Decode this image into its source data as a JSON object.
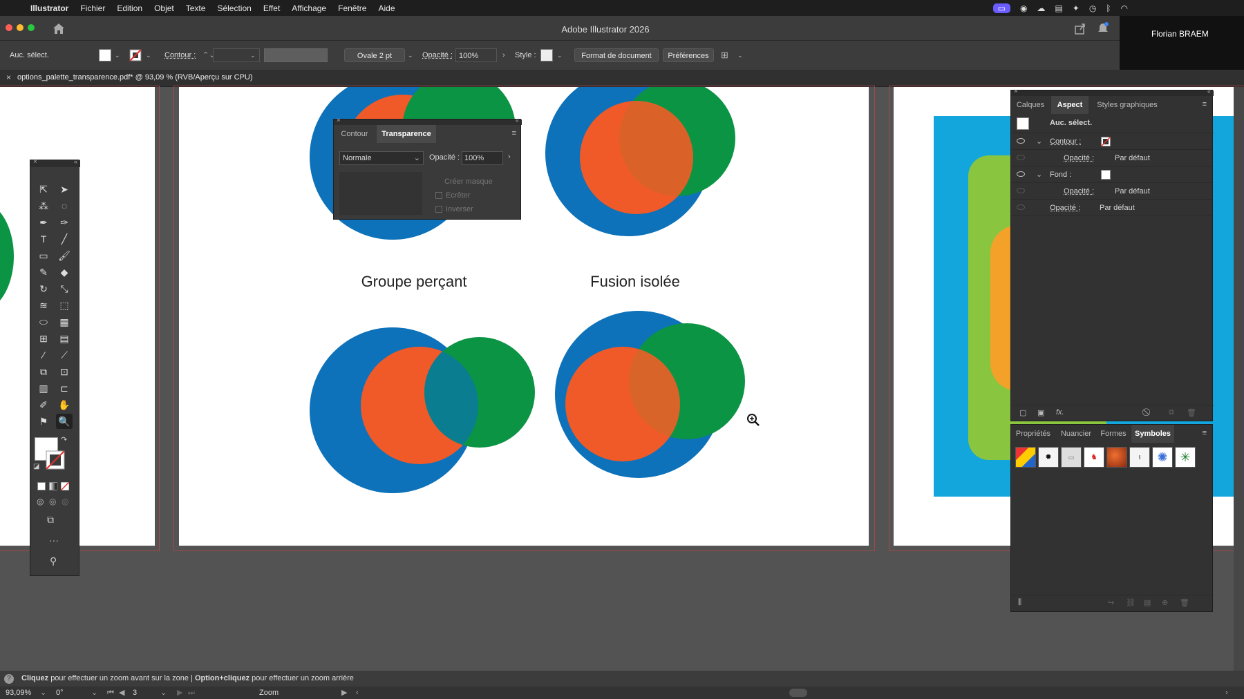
{
  "menubar": {
    "app_name": "Illustrator",
    "items": [
      "Fichier",
      "Edition",
      "Objet",
      "Texte",
      "Sélection",
      "Effet",
      "Affichage",
      "Fenêtre",
      "Aide"
    ]
  },
  "window": {
    "title": "Adobe Illustrator 2026",
    "user": "Florian BRAEM"
  },
  "controlbar": {
    "selection": "Auc. sélect.",
    "contour_label": "Contour :",
    "brush": "Ovale 2 pt",
    "opacity_label": "Opacité :",
    "opacity_value": "100%",
    "style_label": "Style :",
    "doc_format": "Format de document",
    "preferences": "Préférences"
  },
  "document_tab": {
    "title": "options_palette_transparence.pdf* @ 93,09 % (RVB/Aperçu sur CPU)"
  },
  "artwork": {
    "label_left": "Groupe perçant",
    "label_right": "Fusion isolée",
    "colors": {
      "blue": "#0d72b9",
      "orange": "#f05a28",
      "green": "#0b9444"
    }
  },
  "transparency_panel": {
    "tabs": [
      "Contour",
      "Transparence"
    ],
    "blend_mode": "Normale",
    "opacity_label": "Opacité :",
    "opacity_value": "100%",
    "make_mask": "Créer masque",
    "clip": "Ecrêter",
    "invert": "Inverser"
  },
  "aspect_panel": {
    "tabs": [
      "Calques",
      "Aspect",
      "Styles graphiques"
    ],
    "selection": "Auc. sélect.",
    "rows": [
      {
        "label": "Contour :",
        "value": ""
      },
      {
        "label": "Opacité :",
        "value": "Par défaut"
      },
      {
        "label": "Fond :",
        "value": ""
      },
      {
        "label": "Opacité :",
        "value": "Par défaut"
      },
      {
        "label": "Opacité :",
        "value": "Par défaut"
      }
    ],
    "fx_label": "fx."
  },
  "symbols_panel": {
    "tabs": [
      "Propriétés",
      "Nuancier",
      "Formes",
      "Symboles"
    ],
    "count": 8
  },
  "status": {
    "help_bold_1": "Cliquez",
    "help_text_1": "pour effectuer un zoom avant sur la zone",
    "separator": "|",
    "help_bold_2": "Option+cliquez",
    "help_text_2": "pour effectuer un zoom arrière",
    "zoom": "93,09%",
    "angle": "0°",
    "artboard": "3",
    "tool": "Zoom"
  }
}
